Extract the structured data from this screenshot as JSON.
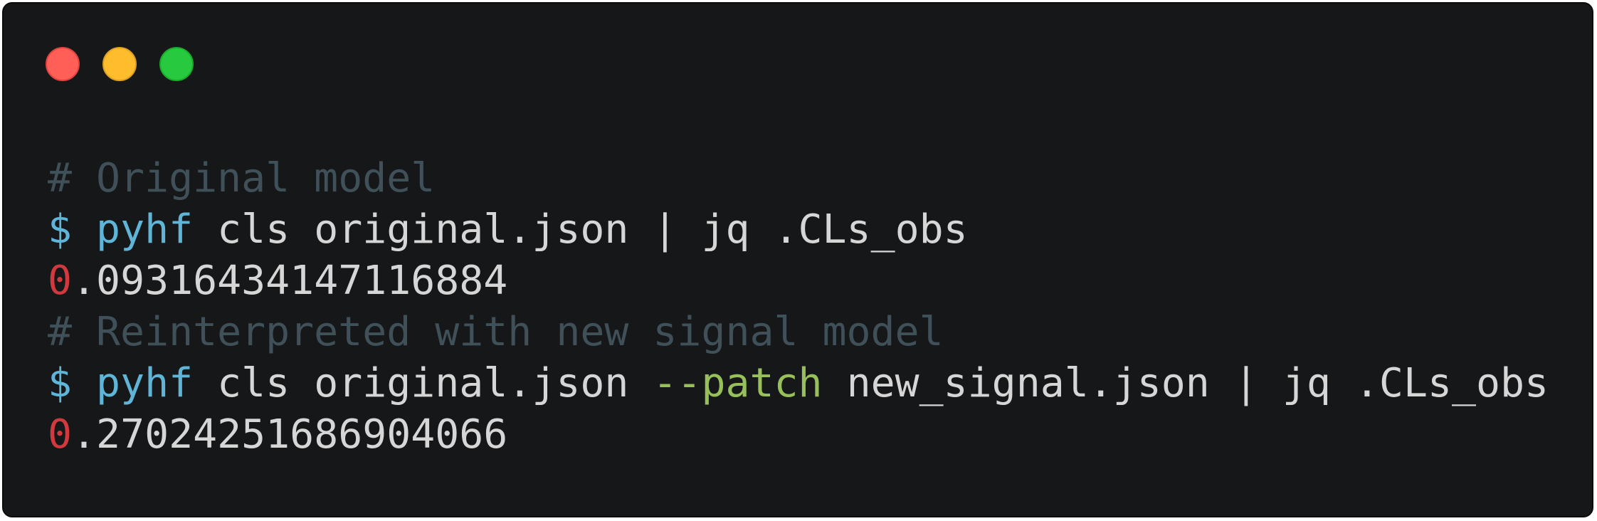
{
  "window": {
    "controls": [
      {
        "name": "close",
        "color": "#ff5f56"
      },
      {
        "name": "minimize",
        "color": "#ffbd2e"
      },
      {
        "name": "maximize",
        "color": "#27c93f"
      }
    ]
  },
  "terminal": {
    "line1": {
      "comment": "# Original model"
    },
    "line2": {
      "prompt": "$ ",
      "command": "pyhf",
      "args": " cls original.json | jq .CLs_obs"
    },
    "line3": {
      "lead": "0",
      "rest": ".09316434147116884"
    },
    "line4": {
      "comment": "# Reinterpreted with new signal model"
    },
    "line5": {
      "prompt": "$ ",
      "command": "pyhf",
      "args_before": " cls original.json ",
      "flag": "--patch",
      "args_after": " new_signal.json | jq .CLs_obs"
    },
    "line6": {
      "lead": "0",
      "rest": ".27024251686904066"
    }
  }
}
